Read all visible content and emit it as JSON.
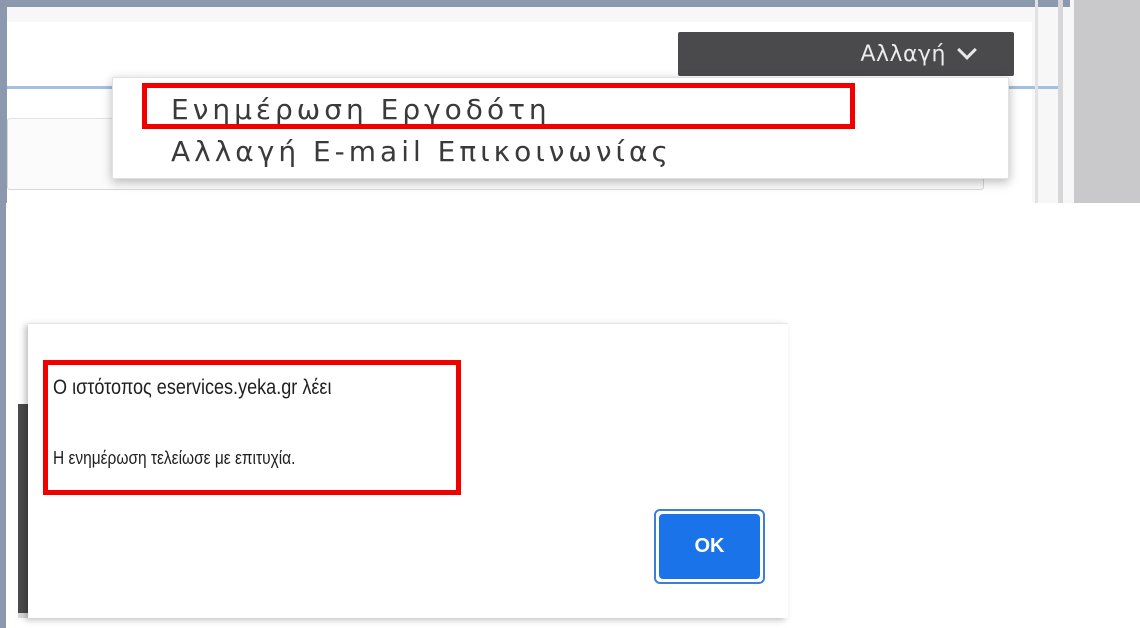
{
  "toolbar": {
    "change_button_label": "Αλλαγή",
    "change_button_icon": "chevron-down-icon"
  },
  "dropdown": {
    "items": [
      {
        "label": "Ενημέρωση Εργοδότη"
      },
      {
        "label": "Αλλαγή E-mail Επικοινωνίας"
      }
    ]
  },
  "dialog": {
    "title": "Ο ιστότοπος  eservices.yeka.gr λέει",
    "message": "Η ενημέρωση τελείωσε με επιτυχία.",
    "ok_label": "OK"
  },
  "colors": {
    "highlight": "#f20000",
    "ok_button": "#1a73e8",
    "change_button_bg": "#4a4a4c"
  }
}
